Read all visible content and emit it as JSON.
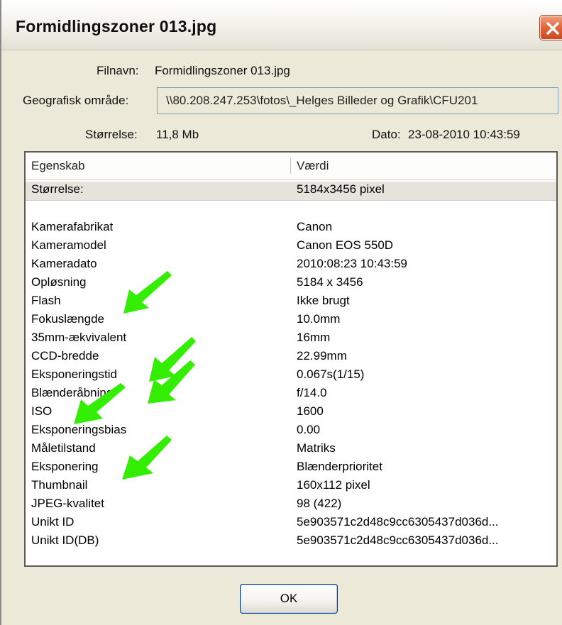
{
  "window": {
    "title": "Formidlingszoner 013.jpg",
    "close_icon": "close-icon",
    "accent_close": "#e06a3e"
  },
  "info": {
    "filename_label": "Filnavn:",
    "filename_value": "Formidlingszoner 013.jpg",
    "geo_label": "Geografisk område:",
    "geo_value": "\\\\80.208.247.253\\fotos\\_Helges Billeder og Grafik\\CFU201",
    "size_label": "Størrelse:",
    "size_value": "11,8 Mb",
    "date_label": "Dato:",
    "date_value": "23-08-2010 10:43:59"
  },
  "table": {
    "headers": [
      "Egenskab",
      "Værdi"
    ],
    "rows": [
      {
        "property": "Størrelse:",
        "value": "5184x3456 pixel"
      },
      {
        "property": "",
        "value": ""
      },
      {
        "property": "Kamerafabrikat",
        "value": "Canon"
      },
      {
        "property": "Kameramodel",
        "value": "Canon EOS 550D"
      },
      {
        "property": "Kameradato",
        "value": "2010:08:23 10:43:59"
      },
      {
        "property": "Opløsning",
        "value": "5184 x 3456"
      },
      {
        "property": "Flash",
        "value": "Ikke brugt"
      },
      {
        "property": "Fokuslængde",
        "value": "10.0mm"
      },
      {
        "property": "35mm-ækvivalent",
        "value": "16mm"
      },
      {
        "property": "CCD-bredde",
        "value": "22.99mm"
      },
      {
        "property": "Eksponeringstid",
        "value": " 0.067s(1/15)"
      },
      {
        "property": "Blænderåbning",
        "value": "f/14.0"
      },
      {
        "property": "ISO",
        "value": "1600"
      },
      {
        "property": "Eksponeringsbias",
        "value": "0.00"
      },
      {
        "property": "Måletilstand",
        "value": "Matriks"
      },
      {
        "property": "Eksponering",
        "value": "Blænderprioritet"
      },
      {
        "property": "Thumbnail",
        "value": "160x112 pixel"
      },
      {
        "property": "JPEG-kvalitet",
        "value": "98 (422)"
      },
      {
        "property": "Unikt ID",
        "value": "5e903571c2d48c9cc6305437d036d..."
      },
      {
        "property": "Unikt ID(DB)",
        "value": "5e903571c2d48c9cc6305437d036d..."
      }
    ]
  },
  "annotations": {
    "arrow_color": "#33ee00",
    "arrow_icon": "green-arrow-icon"
  },
  "buttons": {
    "ok_label": "OK"
  }
}
